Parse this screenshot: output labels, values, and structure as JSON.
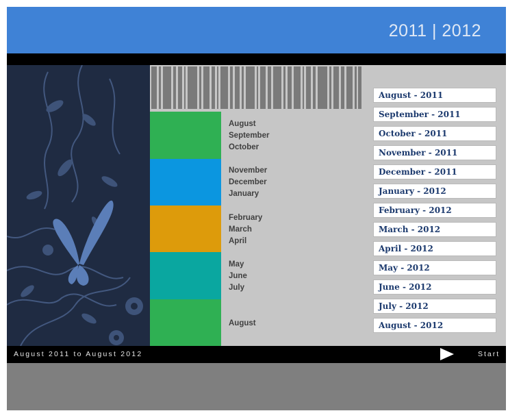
{
  "header": {
    "year_title": "2011 | 2012",
    "bg_color": "#3f82d6"
  },
  "timeline": {
    "bands": [
      {
        "color": "#2fb053",
        "months": [
          "August",
          "September",
          "October"
        ]
      },
      {
        "color": "#0b96e0",
        "months": [
          "November",
          "December",
          "January"
        ]
      },
      {
        "color": "#dd9b0b",
        "months": [
          "February",
          "March",
          "April"
        ]
      },
      {
        "color": "#0aa7a0",
        "months": [
          "May",
          "June",
          "July"
        ]
      },
      {
        "color": "#2fb053",
        "months": [
          "August"
        ]
      }
    ]
  },
  "month_buttons": [
    "August - 2011",
    "September - 2011",
    "October - 2011",
    "November - 2011",
    "December - 2011",
    "January - 2012",
    "February - 2012",
    "March - 2012",
    "April - 2012",
    "May - 2012",
    "June - 2012",
    "July - 2012",
    "August - 2012"
  ],
  "bottom_bar": {
    "range_text": "August 2011 to August 2012",
    "start_label": "Start",
    "play_icon": "play-triangle-icon"
  }
}
